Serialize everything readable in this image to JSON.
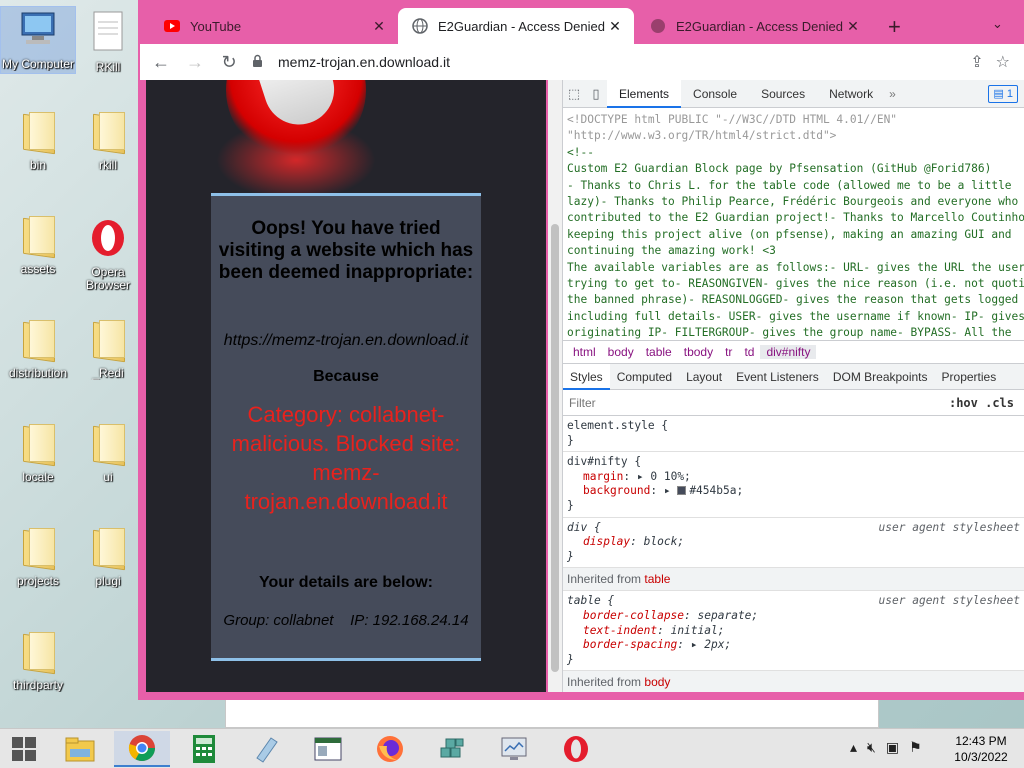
{
  "desktop": {
    "icons": [
      {
        "label": "My Computer"
      },
      {
        "label": "RKill"
      },
      {
        "label": "bin"
      },
      {
        "label": "rkill"
      },
      {
        "label": "assets"
      },
      {
        "label": "Opera Browser"
      },
      {
        "label": "distribution"
      },
      {
        "label": "_Redi"
      },
      {
        "label": "locale"
      },
      {
        "label": "ui"
      },
      {
        "label": "projects"
      },
      {
        "label": "plugi"
      },
      {
        "label": "thirdparty"
      }
    ]
  },
  "browser": {
    "tabs": [
      {
        "title": "YouTube",
        "close": "✕"
      },
      {
        "title": "E2Guardian - Access Denied",
        "close": "✕"
      },
      {
        "title": "E2Guardian - Access Denied",
        "close": "✕"
      }
    ],
    "new_tab": "+",
    "tab_menu": "⌄",
    "url": "memz-trojan.en.download.it",
    "accent": "#e75fa9"
  },
  "page": {
    "heading": "Oops! You have tried visiting a website which has been deemed inappropriate:",
    "blocked_url": "https://memz-trojan.en.download.it",
    "because": "Because",
    "reason": "Category: collabnet-malicious. Blocked site: memz-trojan.en.download.it",
    "details_heading": "Your details are below:",
    "group_ip": "Group: collabnet    IP: 192.168.24.14",
    "box_color": "#454b5a",
    "reason_color": "#e8221d"
  },
  "devtools": {
    "tabs": [
      "Elements",
      "Console",
      "Sources",
      "Network"
    ],
    "more": "»",
    "issues_count": "1",
    "source_lines": [
      {
        "cls": "doctype",
        "text": "<!DOCTYPE html PUBLIC \"-//W3C//DTD HTML 4.01//EN\""
      },
      {
        "cls": "doctype",
        "text": "\"http://www.w3.org/TR/html4/strict.dtd\">"
      },
      {
        "cls": "cmt",
        "text": "<!--"
      },
      {
        "cls": "cmt",
        "text": "Custom E2 Guardian Block page by Pfsensation (GitHub @Forid786)"
      },
      {
        "cls": "cmt",
        "text": "- Thanks to Chris L. for the table code (allowed me to be a little"
      },
      {
        "cls": "cmt",
        "text": "lazy)- Thanks to Philip Pearce, Frédéric Bourgeois and everyone who"
      },
      {
        "cls": "cmt",
        "text": "contributed to the E2 Guardian project!- Thanks to Marcello Coutinho for"
      },
      {
        "cls": "cmt",
        "text": "keeping this project alive (on pfsense), making an amazing GUI and"
      },
      {
        "cls": "cmt",
        "text": "continuing the amazing work! <3"
      },
      {
        "cls": "cmt",
        "text": "The available variables are as follows:- URL- gives the URL the user was"
      },
      {
        "cls": "cmt",
        "text": "trying to get to- REASONGIVEN- gives the nice reason (i.e. not quoting"
      },
      {
        "cls": "cmt",
        "text": "the banned phrase)- REASONLOGGED- gives the reason that gets logged"
      },
      {
        "cls": "cmt",
        "text": "including full details- USER- gives the username if known- IP- gives the"
      },
      {
        "cls": "cmt",
        "text": "originating IP- FILTERGROUP- gives the group name- BYPASS- All the"
      }
    ],
    "breadcrumbs": [
      "html",
      "body",
      "table",
      "tbody",
      "tr",
      "td",
      "div#nifty"
    ],
    "sub_tabs": [
      "Styles",
      "Computed",
      "Layout",
      "Event Listeners",
      "DOM Breakpoints",
      "Properties"
    ],
    "filter_placeholder": "Filter",
    "hov_cls": ":hov .cls",
    "styles": {
      "element_style": "element.style {",
      "close_brace": "}",
      "nifty_selector": "div#nifty {",
      "margin_name": "margin",
      "margin_value": "▸ 0 10%;",
      "background_name": "background",
      "background_value": "#454b5a;",
      "div_selector": "div {",
      "user_agent": "user agent stylesheet",
      "display_name": "display",
      "display_value": "block;",
      "inherited_table": "Inherited from",
      "inherited_table_el": "table",
      "table_selector": "table {",
      "bc_name": "border-collapse",
      "bc_value": "separate;",
      "ti_name": "text-indent",
      "ti_value": "initial;",
      "bs_name": "border-spacing",
      "bs_value": "▸ 2px;",
      "inherited_body": "Inherited from",
      "inherited_body_el": "body"
    }
  },
  "taskbar": {
    "time": "12:43 PM",
    "date": "10/3/2022"
  }
}
